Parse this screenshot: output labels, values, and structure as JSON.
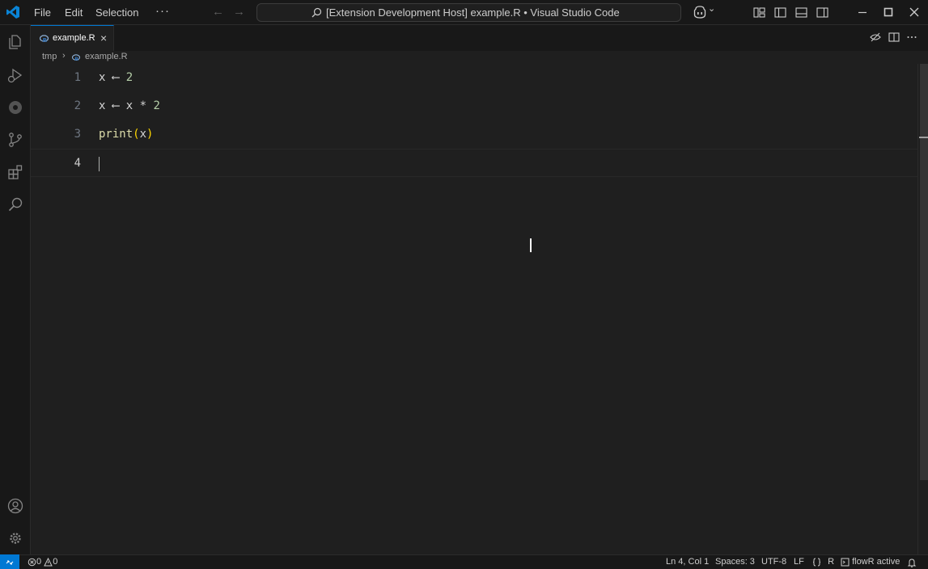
{
  "titlebar": {
    "menus": [
      "File",
      "Edit",
      "Selection"
    ],
    "more": "···",
    "back_arrow": "←",
    "forward_arrow": "→",
    "command_center": "[Extension Development Host] example.R • Visual Studio Code",
    "copilot_chevron": "⌄"
  },
  "tabs": [
    {
      "label": "example.R",
      "close": "×",
      "active": true
    }
  ],
  "breadcrumb": {
    "folder": "tmp",
    "separator": "›",
    "file": "example.R"
  },
  "editor": {
    "current_line": 4,
    "lines": [
      {
        "number": "1",
        "tokens": [
          [
            "x",
            "var"
          ],
          [
            " ⟵ ",
            "op"
          ],
          [
            "2",
            "num"
          ]
        ]
      },
      {
        "number": "2",
        "tokens": [
          [
            "x",
            "var"
          ],
          [
            " ⟵ ",
            "op"
          ],
          [
            "x",
            "var"
          ],
          [
            " * ",
            "op"
          ],
          [
            "2",
            "num"
          ]
        ]
      },
      {
        "number": "3",
        "tokens": [
          [
            "print",
            "fn"
          ],
          [
            "(",
            "paren"
          ],
          [
            "x",
            "var"
          ],
          [
            ")",
            "paren"
          ]
        ]
      },
      {
        "number": "4",
        "tokens": []
      }
    ]
  },
  "statusbar": {
    "errors": "0",
    "warnings": "0",
    "position": "Ln 4, Col 1",
    "spaces": "Spaces: 3",
    "encoding": "UTF-8",
    "eol": "LF",
    "language": "R",
    "extension_status": "flowR active"
  },
  "colors": {
    "accent": "#0078d4",
    "background": "#1f1f1f",
    "chrome": "#181818"
  }
}
